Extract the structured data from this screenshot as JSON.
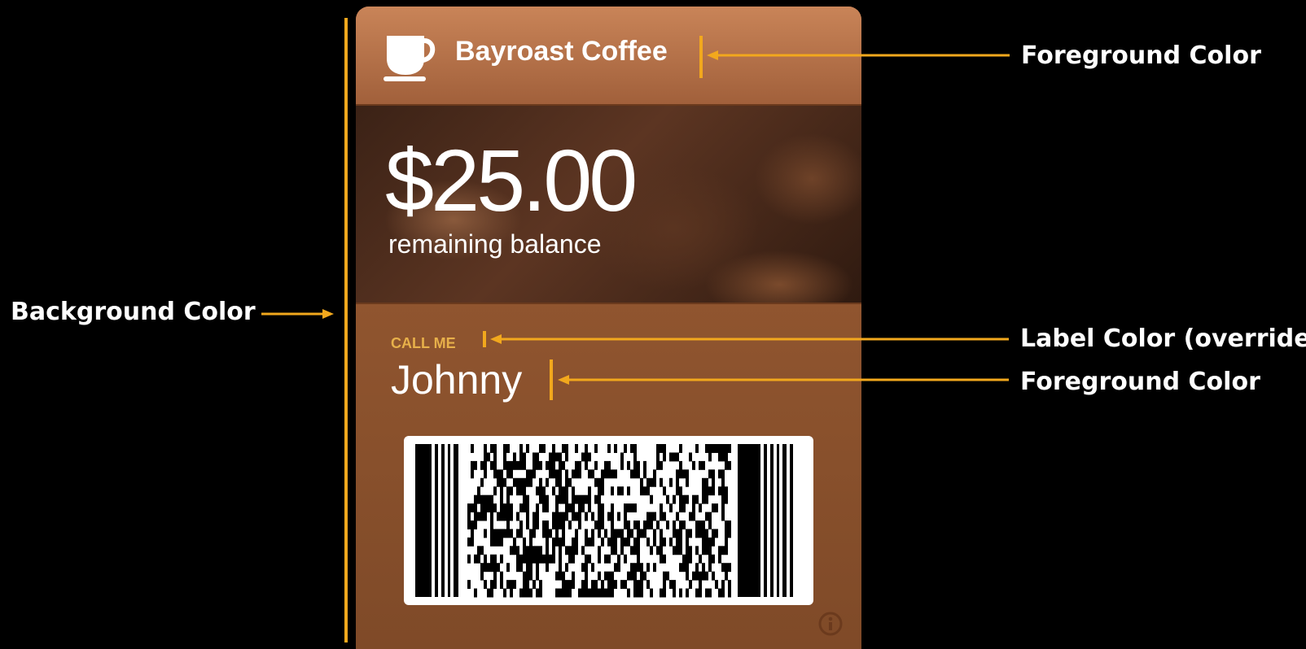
{
  "annotations": {
    "background_color": "Background Color",
    "foreground_color_top": "Foreground Color",
    "label_color_override": "Label Color (override)",
    "foreground_color_bottom": "Foreground Color"
  },
  "pass": {
    "title": "Bayroast Coffee",
    "balance": "$25.00",
    "balance_label": "remaining balance",
    "field_label": "CALL ME",
    "field_value": "Johnny"
  },
  "colors": {
    "annotation_accent": "#f2a81d",
    "label_color": "#e7b04a",
    "foreground": "#ffffff",
    "background": "#91552f"
  },
  "icons": {
    "logo": "coffee-cup-icon",
    "info": "info-icon"
  }
}
